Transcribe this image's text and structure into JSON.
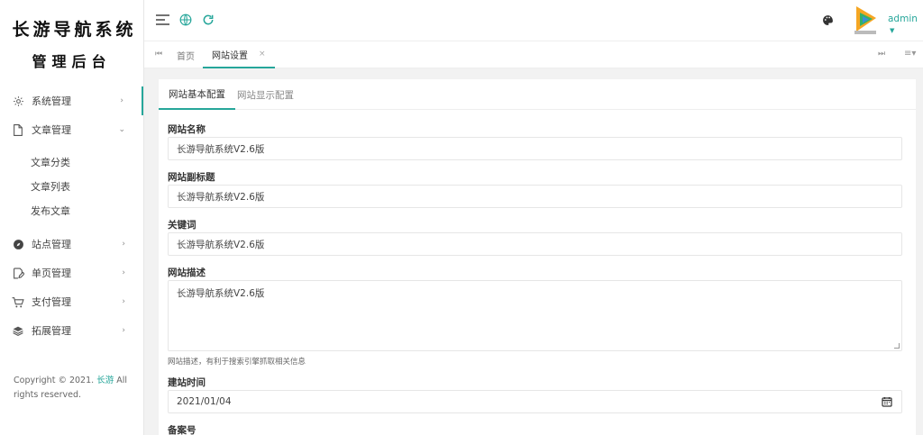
{
  "logo": {
    "line1": "长游导航系统",
    "line2": "管理后台"
  },
  "sidebar": {
    "items": [
      {
        "label": "系统管理",
        "icon": "gear-icon",
        "arrow": "›"
      },
      {
        "label": "文章管理",
        "icon": "document-icon",
        "arrow": "⌄"
      },
      {
        "label": "站点管理",
        "icon": "compass-icon",
        "arrow": "›"
      },
      {
        "label": "单页管理",
        "icon": "edit-page-icon",
        "arrow": "›"
      },
      {
        "label": "支付管理",
        "icon": "cart-icon",
        "arrow": "›"
      },
      {
        "label": "拓展管理",
        "icon": "layers-icon",
        "arrow": "›"
      }
    ],
    "sub_items": [
      "文章分类",
      "文章列表",
      "发布文章"
    ],
    "copyright_prefix": "Copyright © 2021.",
    "copyright_link": "长游",
    "copyright_suffix": "All rights reserved."
  },
  "header": {
    "username": "admin"
  },
  "tabs": {
    "home": "首页",
    "current": "网站设置",
    "close": "×"
  },
  "card": {
    "tabs": [
      "网站基本配置",
      "网站显示配置"
    ],
    "fields": {
      "site_name_label": "网站名称",
      "site_name_value": "长游导航系统V2.6版",
      "subtitle_label": "网站副标题",
      "subtitle_value": "长游导航系统V2.6版",
      "keywords_label": "关键词",
      "keywords_value": "长游导航系统V2.6版",
      "description_label": "网站描述",
      "description_value": "长游导航系统V2.6版",
      "description_help": "网站描述，有利于搜索引擎抓取相关信息",
      "build_date_label": "建站时间",
      "build_date_value": "2021/01/04",
      "icp_label": "备案号"
    }
  },
  "colors": {
    "accent": "#26a69a"
  }
}
